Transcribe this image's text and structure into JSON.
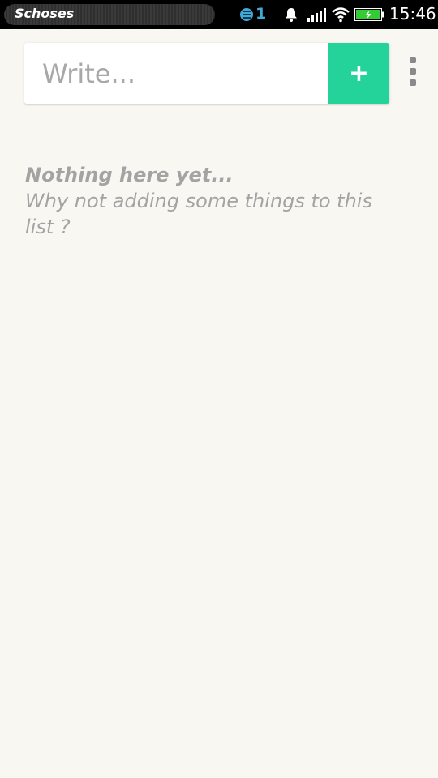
{
  "status_bar": {
    "app_name": "Schoses",
    "notification_count": "1",
    "time": "15:46"
  },
  "composer": {
    "placeholder": "Write...",
    "add_label": "+"
  },
  "empty_state": {
    "title": "Nothing here yet...",
    "subtitle": "Why not adding some things to this list ?"
  },
  "colors": {
    "accent": "#23d39a",
    "background": "#f8f7f2",
    "empty_text": "#a3a3a3",
    "notification": "#42a9d6",
    "battery": "#33cc33"
  },
  "icons": [
    "notification-icon",
    "bell-icon",
    "signal-icon",
    "wifi-icon",
    "battery-charging-icon",
    "overflow-menu-icon",
    "plus-icon"
  ]
}
